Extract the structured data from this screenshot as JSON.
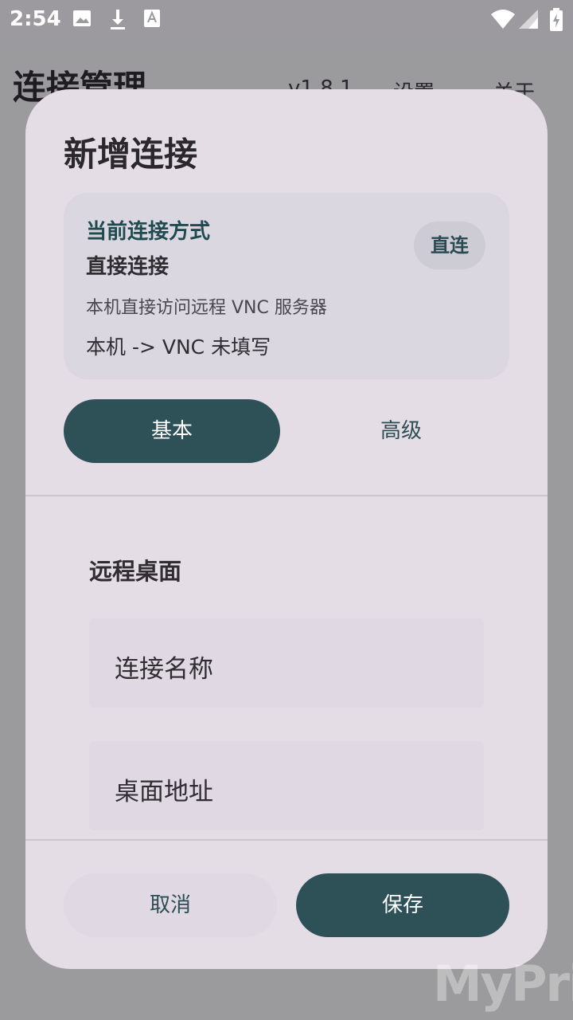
{
  "status_bar": {
    "time": "2:54",
    "icons": [
      "image-icon",
      "download-icon",
      "text-a-icon",
      "wifi-icon",
      "signal-icon",
      "battery-charging-icon"
    ]
  },
  "app": {
    "title": "连接管理",
    "menu": [
      "v1.8.1",
      "设置",
      "关于"
    ]
  },
  "dialog": {
    "title": "新增连接",
    "mode_card": {
      "heading": "当前连接方式",
      "mode_name": "直接连接",
      "description": "本机直接访问远程 VNC 服务器",
      "route": "本机 -> VNC 未填写",
      "chip": "直连"
    },
    "tabs": [
      {
        "label": "基本",
        "active": true
      },
      {
        "label": "高级",
        "active": false
      }
    ],
    "section_title": "远程桌面",
    "fields": [
      {
        "label": "连接名称"
      },
      {
        "label": "桌面地址"
      }
    ],
    "buttons": {
      "cancel": "取消",
      "save": "保存"
    }
  },
  "colors": {
    "accent": "#2d5157",
    "dialog_bg": "#e4dde6",
    "scrim": "#9b9a9c"
  },
  "watermark": "MyPrice"
}
